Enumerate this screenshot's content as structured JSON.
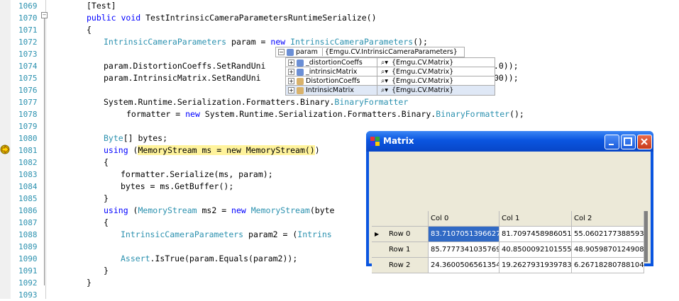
{
  "editor": {
    "lines": [
      {
        "no": "1069",
        "text": "[Test]"
      },
      {
        "no": "1070",
        "parts": [
          [
            "kw",
            "public "
          ],
          [
            "kw",
            "void "
          ],
          [
            "",
            "TestIntrinsicCameraParametersRuntimeSerialize()"
          ]
        ]
      },
      {
        "no": "1071",
        "text": "{"
      },
      {
        "no": "1072",
        "parts": [
          [
            "ty",
            "IntrinsicCameraParameters"
          ],
          [
            "",
            " param = "
          ],
          [
            "kw",
            "new "
          ],
          [
            "ty",
            "IntrinsicCameraParameters"
          ],
          [
            "",
            "();"
          ]
        ]
      },
      {
        "no": "1073",
        "text": ""
      },
      {
        "no": "1074",
        "text": "param.DistortionCoeffs.SetRandUni"
      },
      {
        "no": "1075",
        "text": "param.IntrinsicMatrix.SetRandUni"
      },
      {
        "no": "1076",
        "text": ""
      },
      {
        "no": "1077",
        "parts": [
          [
            "",
            "System.Runtime.Serialization.Formatters.Binary."
          ],
          [
            "ty",
            "BinaryFormatter"
          ]
        ]
      },
      {
        "no": "1078",
        "parts": [
          [
            "",
            "formatter = "
          ],
          [
            "kw",
            "new "
          ],
          [
            "",
            "System.Runtime.Serialization.Formatters.Binary."
          ],
          [
            "ty",
            "BinaryFormatter"
          ],
          [
            "",
            "();"
          ]
        ]
      },
      {
        "no": "1079",
        "text": ""
      },
      {
        "no": "1080",
        "parts": [
          [
            "ty",
            "Byte"
          ],
          [
            "",
            "[] bytes;"
          ]
        ]
      },
      {
        "no": "1081",
        "parts": [
          [
            "kw",
            "using "
          ],
          [
            "",
            "("
          ],
          [
            "hl",
            "MemoryStream ms = new MemoryStream()"
          ],
          [
            "",
            ")"
          ]
        ]
      },
      {
        "no": "1082",
        "text": "{"
      },
      {
        "no": "1083",
        "text": "formatter.Serialize(ms, param);"
      },
      {
        "no": "1084",
        "text": "bytes = ms.GetBuffer();"
      },
      {
        "no": "1085",
        "text": "}"
      },
      {
        "no": "1086",
        "parts": [
          [
            "kw",
            "using "
          ],
          [
            "",
            "("
          ],
          [
            "ty",
            "MemoryStream"
          ],
          [
            "",
            " ms2 = "
          ],
          [
            "kw",
            "new "
          ],
          [
            "ty",
            "MemoryStream"
          ],
          [
            "",
            "(byte"
          ]
        ]
      },
      {
        "no": "1087",
        "text": "{"
      },
      {
        "no": "1088",
        "parts": [
          [
            "ty",
            "IntrinsicCameraParameters"
          ],
          [
            "",
            " param2 = ("
          ],
          [
            "ty",
            "Intrins"
          ]
        ]
      },
      {
        "no": "1089",
        "text": ""
      },
      {
        "no": "1090",
        "parts": [
          [
            "ty",
            "Assert"
          ],
          [
            "",
            ".IsTrue(param.Equals(param2));"
          ]
        ]
      },
      {
        "no": "1091",
        "text": "}"
      },
      {
        "no": "1092",
        "text": "}"
      },
      {
        "no": "1093",
        "text": ""
      }
    ],
    "trail_1074": "1.0));",
    "trail_1075": "00));"
  },
  "datatip": {
    "root_name": "param",
    "root_value": "{Emgu.CV.IntrinsicCameraParameters}",
    "children": [
      {
        "name": "_distortionCoeffs",
        "value": "{Emgu.CV.Matrix<double>}"
      },
      {
        "name": "_intrinsicMatrix",
        "value": "{Emgu.CV.Matrix<double>}"
      },
      {
        "name": "DistortionCoeffs",
        "value": "{Emgu.CV.Matrix<double>}"
      },
      {
        "name": "IntrinsicMatrix",
        "value": "{Emgu.CV.Matrix<double>}"
      }
    ]
  },
  "window": {
    "title": "Matrix",
    "columns": [
      "Col 0",
      "Col 1",
      "Col 2"
    ],
    "rows": [
      {
        "label": "Row 0",
        "cells": [
          "83.7107051396627",
          "81.7097458986051",
          "55.0602177388593"
        ]
      },
      {
        "label": "Row 1",
        "cells": [
          "85.7777341035769",
          "40.8500092101555",
          "48.9059870124908"
        ]
      },
      {
        "label": "Row 2",
        "cells": [
          "24.3600506561354",
          "19.2627931939783",
          "6.26718280788104"
        ]
      }
    ]
  },
  "colors": {
    "keyword": "#0000ff",
    "type": "#2b91af",
    "highlight": "#fff39c",
    "selection": "#316ac5"
  }
}
